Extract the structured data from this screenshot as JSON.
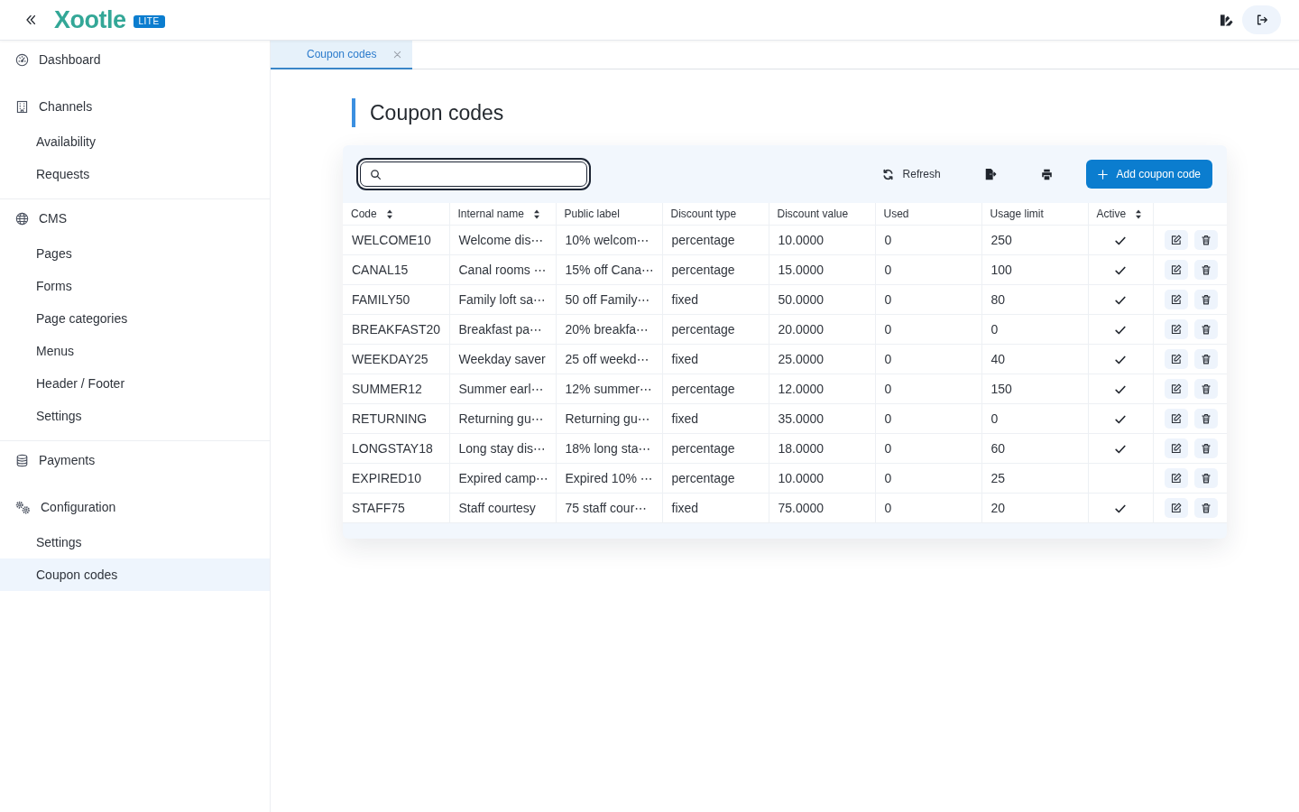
{
  "header": {
    "logo": "Xootle",
    "badge": "LITE"
  },
  "sidebar": {
    "groups": [
      {
        "label": "Dashboard",
        "selected": false
      },
      {
        "label": "Channels",
        "selected": false,
        "children": [
          {
            "label": "Availability",
            "selected": false
          },
          {
            "label": "Requests",
            "selected": false
          }
        ]
      },
      {
        "label": "CMS",
        "selected": false,
        "children": [
          {
            "label": "Pages",
            "selected": false
          },
          {
            "label": "Forms",
            "selected": false
          },
          {
            "label": "Page categories",
            "selected": false
          },
          {
            "label": "Menus",
            "selected": false
          },
          {
            "label": "Header / Footer",
            "selected": false
          },
          {
            "label": "Settings",
            "selected": false
          }
        ]
      },
      {
        "label": "Payments",
        "selected": false
      },
      {
        "label": "Configuration",
        "selected": false,
        "children": [
          {
            "label": "Settings",
            "selected": false
          },
          {
            "label": "Coupon codes",
            "selected": true
          }
        ]
      }
    ]
  },
  "tabs": [
    {
      "label": "Coupon codes",
      "selected": true
    }
  ],
  "page": {
    "title": "Coupon codes"
  },
  "toolbar": {
    "search": {
      "focused": true
    },
    "actions": [
      {
        "kind": "refresh",
        "label": "Refresh"
      },
      {
        "kind": "export"
      },
      {
        "kind": "print"
      },
      {
        "kind": "add",
        "label": "Add coupon code"
      }
    ]
  },
  "table": {
    "columns": [
      {
        "label": "Code",
        "sortable": true
      },
      {
        "label": "Internal name",
        "sortable": true
      },
      {
        "label": "Public label",
        "sortable": false
      },
      {
        "label": "Discount type",
        "sortable": false
      },
      {
        "label": "Discount value",
        "sortable": false
      },
      {
        "label": "Used",
        "sortable": false
      },
      {
        "label": "Usage limit",
        "sortable": false
      },
      {
        "label": "Active",
        "sortable": true
      }
    ],
    "rows": [
      {
        "cells": [
          "WELCOME10",
          "Welcome dis⋯",
          "10% welcom⋯",
          "percentage",
          "10.0000",
          "0",
          "250"
        ],
        "active": true
      },
      {
        "cells": [
          "CANAL15",
          "Canal rooms ⋯",
          "15% off Cana⋯",
          "percentage",
          "15.0000",
          "0",
          "100"
        ],
        "active": true
      },
      {
        "cells": [
          "FAMILY50",
          "Family loft sa⋯",
          "50 off Family⋯",
          "fixed",
          "50.0000",
          "0",
          "80"
        ],
        "active": true
      },
      {
        "cells": [
          "BREAKFAST20",
          "Breakfast pa⋯",
          "20% breakfa⋯",
          "percentage",
          "20.0000",
          "0",
          "0"
        ],
        "active": true
      },
      {
        "cells": [
          "WEEKDAY25",
          "Weekday saver",
          "25 off weekd⋯",
          "fixed",
          "25.0000",
          "0",
          "40"
        ],
        "active": true
      },
      {
        "cells": [
          "SUMMER12",
          "Summer earl⋯",
          "12% summer⋯",
          "percentage",
          "12.0000",
          "0",
          "150"
        ],
        "active": true
      },
      {
        "cells": [
          "RETURNING",
          "Returning gu⋯",
          "Returning gu⋯",
          "fixed",
          "35.0000",
          "0",
          "0"
        ],
        "active": true
      },
      {
        "cells": [
          "LONGSTAY18",
          "Long stay dis⋯",
          "18% long sta⋯",
          "percentage",
          "18.0000",
          "0",
          "60"
        ],
        "active": true
      },
      {
        "cells": [
          "EXPIRED10",
          "Expired camp⋯",
          "Expired 10% ⋯",
          "percentage",
          "10.0000",
          "0",
          "25"
        ],
        "active": false
      },
      {
        "cells": [
          "STAFF75",
          "Staff courtesy",
          "75 staff cour⋯",
          "fixed",
          "75.0000",
          "0",
          "20"
        ],
        "active": true
      }
    ]
  }
}
